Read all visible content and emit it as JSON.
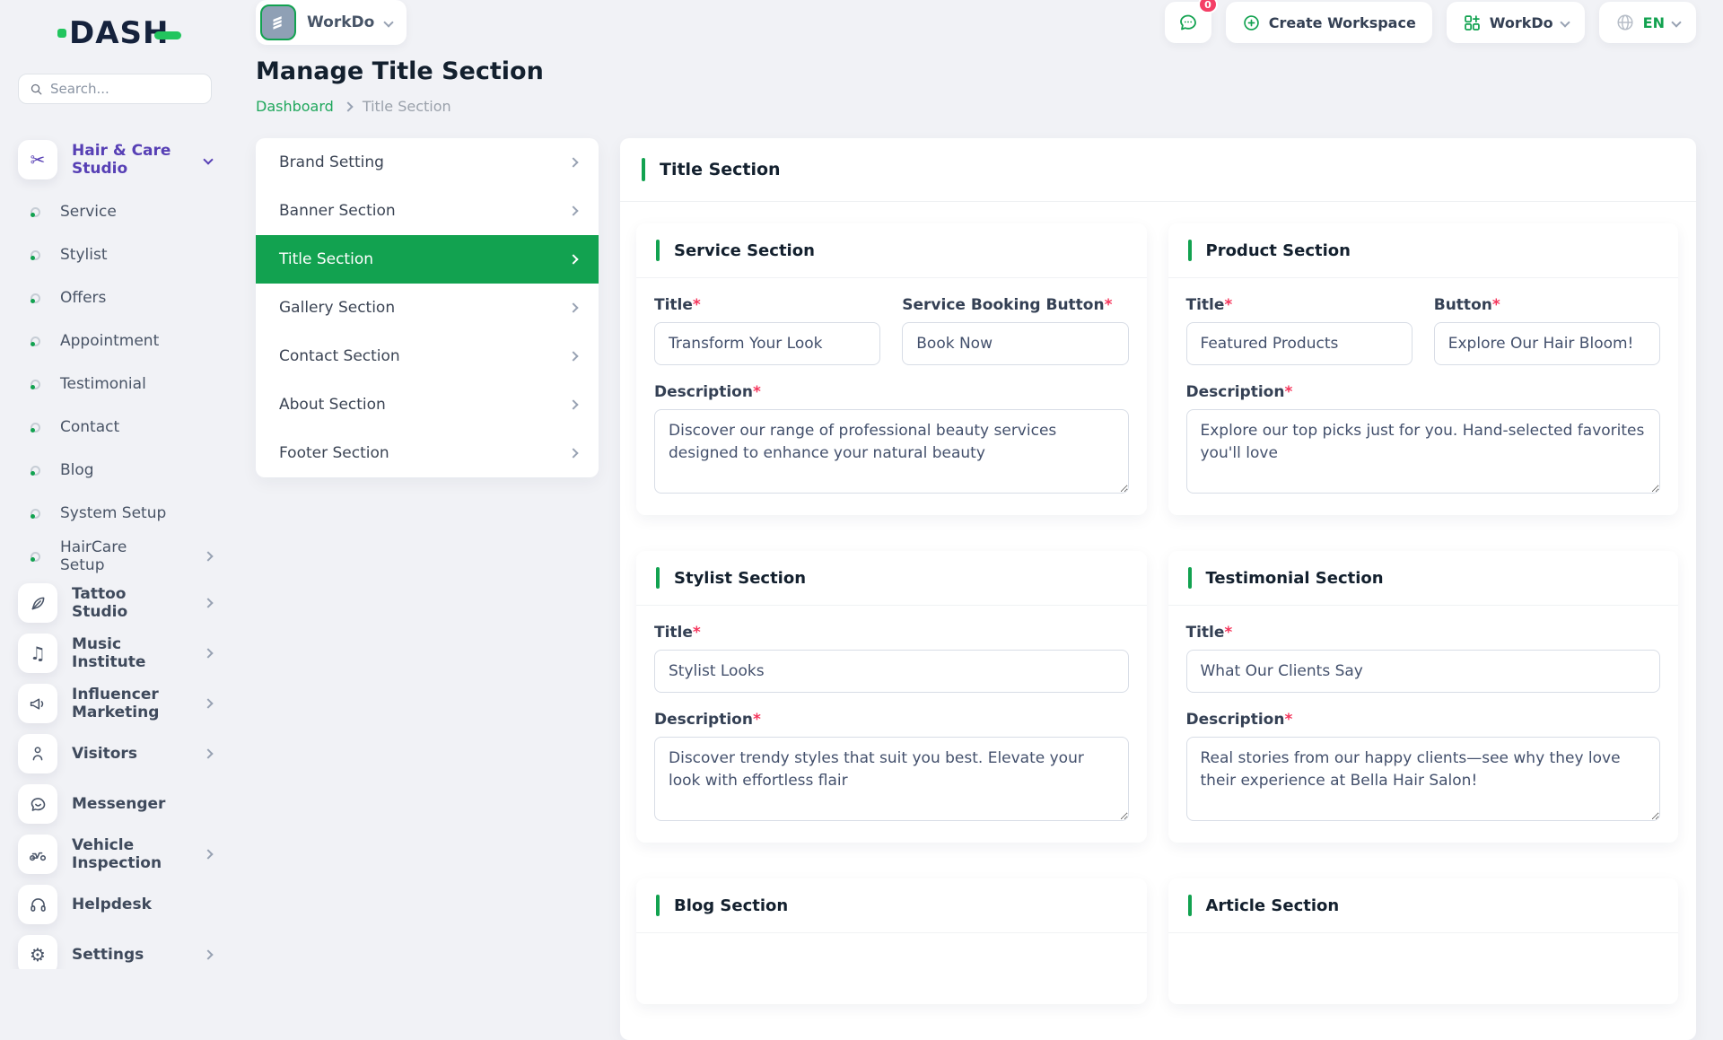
{
  "ui": {
    "required_marker": "*"
  },
  "brand": {
    "logo": "DASH"
  },
  "topbar": {
    "workspace_selector": "WorkDo",
    "chat_badge": "0",
    "create_workspace": "Create Workspace",
    "app_menu": "WorkDo",
    "language": "EN"
  },
  "sidebar": {
    "search_placeholder": "Search...",
    "active_group": "Hair & Care Studio",
    "sub_items": [
      "Service",
      "Stylist",
      "Offers",
      "Appointment",
      "Testimonial",
      "Contact",
      "Blog",
      "System Setup",
      "HairCare Setup"
    ],
    "groups": [
      "Tattoo Studio",
      "Music Institute",
      "Influencer Marketing",
      "Visitors",
      "Messenger",
      "Vehicle Inspection",
      "Helpdesk",
      "Settings"
    ],
    "group_icons": [
      "feather-icon",
      "music-icon",
      "megaphone-icon",
      "person-icon",
      "chat-icon",
      "moped-icon",
      "headset-icon",
      "gear-icon"
    ]
  },
  "page": {
    "title": "Manage Title Section",
    "breadcrumb_home": "Dashboard",
    "breadcrumb_current": "Title Section"
  },
  "settings_menu": [
    "Brand Setting",
    "Banner Section",
    "Title Section",
    "Gallery Section",
    "Contact Section",
    "About Section",
    "Footer Section"
  ],
  "content": {
    "panel_title": "Title Section",
    "sections": {
      "service": {
        "title": "Service Section",
        "title_label": "Title",
        "title_value": "Transform Your Look",
        "button_label": "Service Booking Button",
        "button_value": "Book Now",
        "description_label": "Description",
        "description_value": "Discover our range of professional beauty services designed to enhance your natural beauty"
      },
      "product": {
        "title": "Product Section",
        "title_label": "Title",
        "title_value": "Featured Products",
        "button_label": "Button",
        "button_value": "Explore Our Hair Bloom!",
        "description_label": "Description",
        "description_value": "Explore our top picks just for you. Hand-selected favorites you'll love"
      },
      "stylist": {
        "title": "Stylist Section",
        "title_label": "Title",
        "title_value": "Stylist Looks",
        "description_label": "Description",
        "description_value": "Discover trendy styles that suit you best. Elevate your look with effortless flair"
      },
      "testimonial": {
        "title": "Testimonial Section",
        "title_label": "Title",
        "title_value": "What Our Clients Say",
        "description_label": "Description",
        "description_value": "Real stories from our happy clients—see why they love their experience at Bella Hair Salon!"
      },
      "blog": {
        "title": "Blog Section"
      },
      "article": {
        "title": "Article Section"
      }
    }
  },
  "colors": {
    "primary_green": "#12a250",
    "accent_purple": "#5740b5",
    "badge_red": "#f43f66"
  }
}
